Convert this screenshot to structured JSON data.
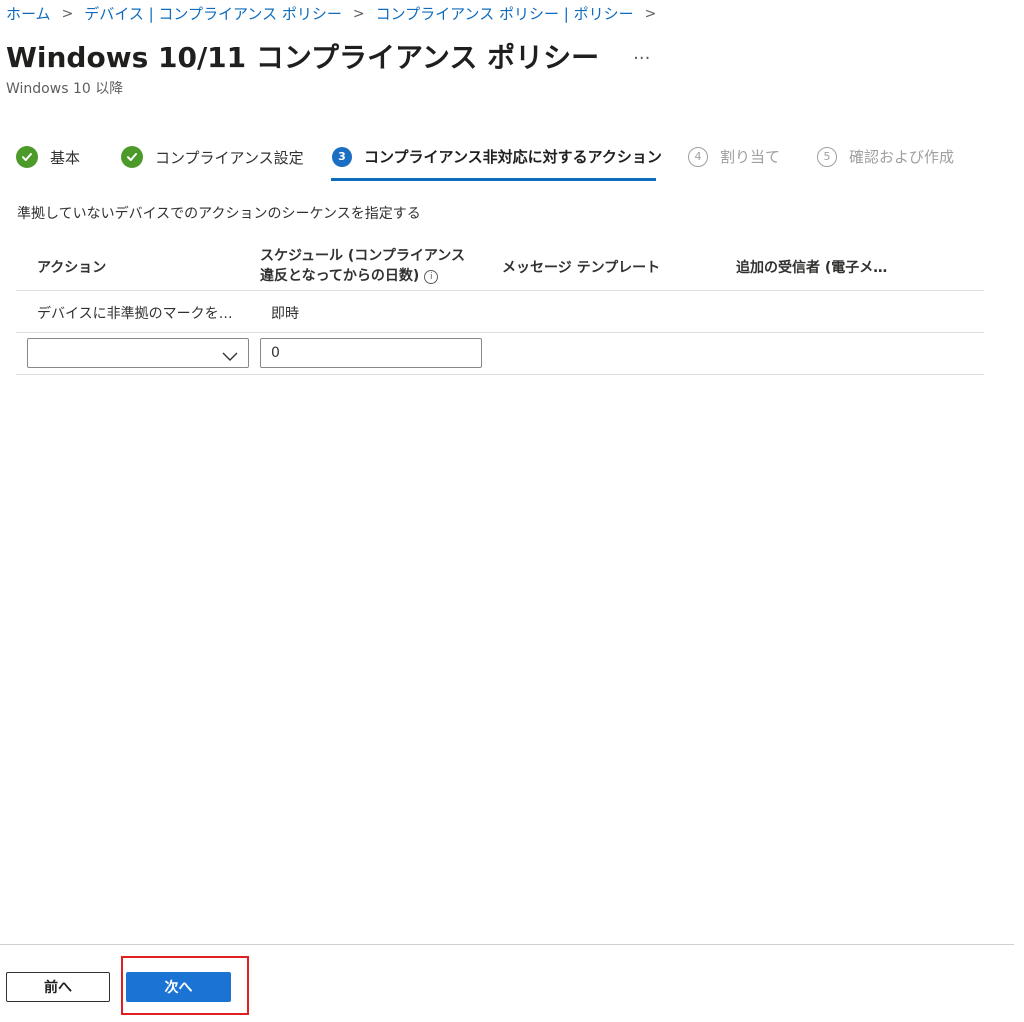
{
  "breadcrumb": [
    {
      "label": "ホーム"
    },
    {
      "label": "デバイス | コンプライアンス ポリシー"
    },
    {
      "label": "コンプライアンス ポリシー | ポリシー"
    }
  ],
  "header": {
    "title": "Windows 10/11 コンプライアンス ポリシー",
    "more": "···",
    "subtitle": "Windows 10 以降"
  },
  "wizard": {
    "steps": [
      {
        "label": "基本",
        "state": "done"
      },
      {
        "label": "コンプライアンス設定",
        "state": "done"
      },
      {
        "number": "3",
        "label": "コンプライアンス非対応に対するアクション",
        "state": "active"
      },
      {
        "number": "4",
        "label": "割り当て",
        "state": "todo"
      },
      {
        "number": "5",
        "label": "確認および作成",
        "state": "todo"
      }
    ]
  },
  "description": "準拠していないデバイスでのアクションのシーケンスを指定する",
  "table": {
    "headers": {
      "action": "アクション",
      "schedule_line1": "スケジュール (コンプライアンス",
      "schedule_line2": "違反となってからの日数)",
      "message_template": "メッセージ テンプレート",
      "recipients": "追加の受信者 (電子メ…"
    },
    "rows": [
      {
        "action": "デバイスに非準拠のマークを…",
        "schedule": "即時"
      }
    ],
    "new_row": {
      "action_value": "",
      "schedule_value": "0"
    }
  },
  "footer": {
    "prev_label": "前へ",
    "next_label": "次へ"
  },
  "colors": {
    "accent": "#0f6cbd",
    "success": "#4c9a2a",
    "highlight": "#e02020"
  }
}
